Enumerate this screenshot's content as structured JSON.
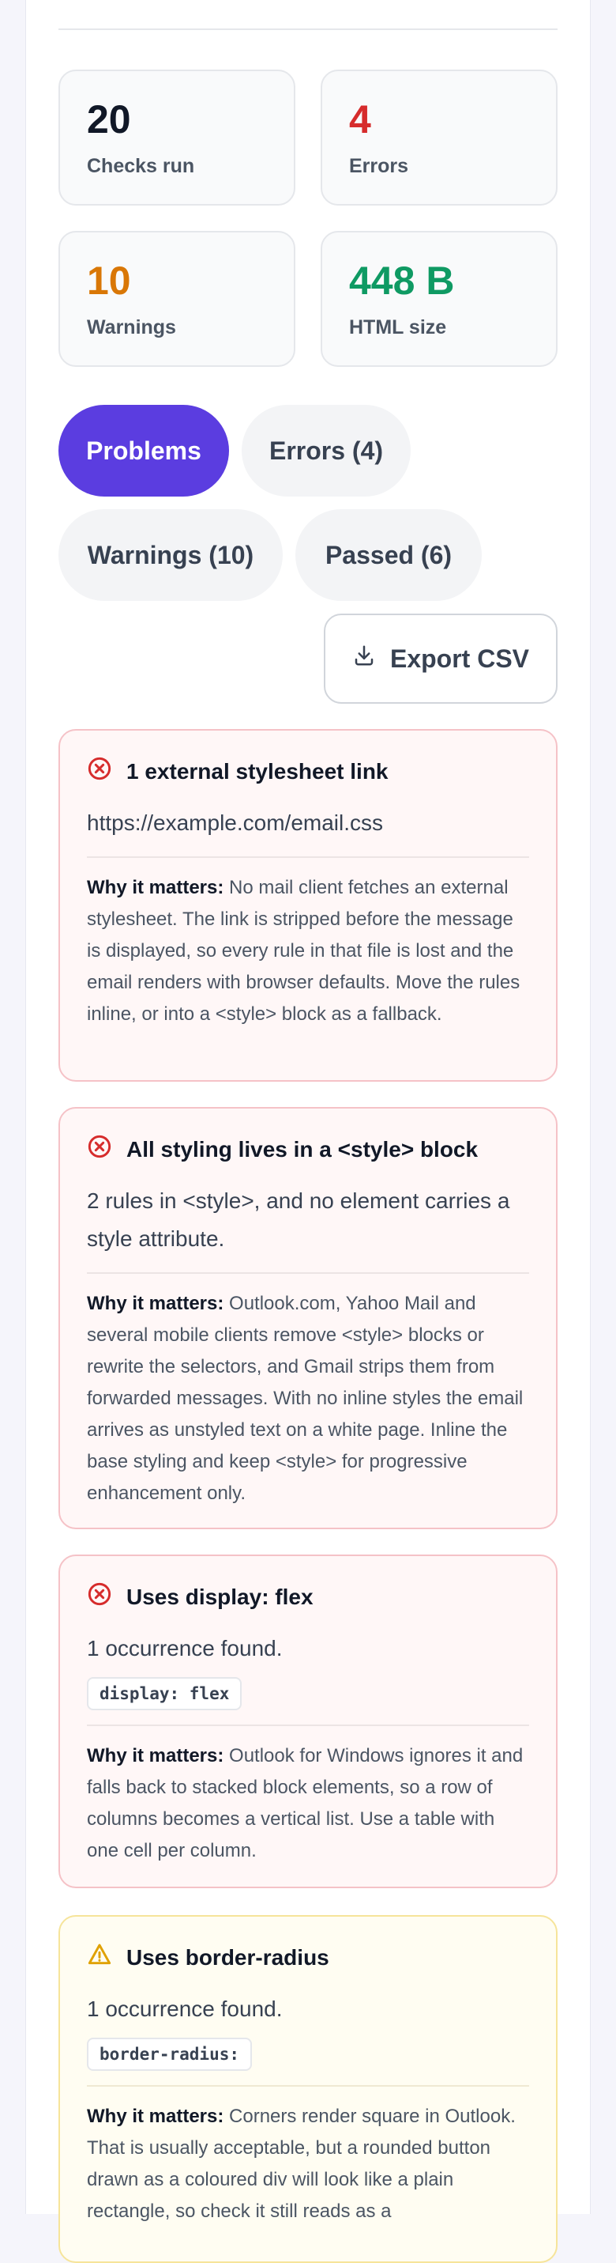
{
  "stats": [
    {
      "value": "20",
      "label": "Checks run",
      "color": "#111827"
    },
    {
      "value": "4",
      "label": "Errors",
      "color": "#d62c2c"
    },
    {
      "value": "10",
      "label": "Warnings",
      "color": "#d97706"
    },
    {
      "value": "448 B",
      "label": "HTML size",
      "color": "#0f9a63"
    }
  ],
  "filters": {
    "problems": "Problems",
    "errors": "Errors (4)",
    "warnings": "Warnings (10)",
    "passed": "Passed (6)",
    "active": "Problems",
    "active_color": "#5b3de0"
  },
  "export_label": "Export CSV",
  "why_label": "Why it matters:",
  "issues": [
    {
      "severity": "error",
      "icon": "error-circle-icon",
      "title": "1 external stylesheet link",
      "detail": "https://example.com/email.css",
      "why": "No mail client fetches an external stylesheet. The link is stripped before the message is displayed, so every rule in that file is lost and the email renders with browser defaults. Move the rules inline, or into a <style> block as a fallback."
    },
    {
      "severity": "error",
      "icon": "error-circle-icon",
      "title": "All styling lives in a <style> block",
      "detail": "2 rules in <style>, and no element carries a style attribute.",
      "why": "Outlook.com, Yahoo Mail and several mobile clients remove <style> blocks or rewrite the selectors, and Gmail strips them from forwarded messages. With no inline styles the email arrives as unstyled text on a white page. Inline the base styling and keep <style> for progressive enhancement only."
    },
    {
      "severity": "error",
      "icon": "error-circle-icon",
      "title": "Uses display: flex",
      "detail": "1 occurrence found.",
      "code": "display: flex",
      "why": "Outlook for Windows ignores it and falls back to stacked block elements, so a row of columns becomes a vertical list. Use a table with one cell per column."
    },
    {
      "severity": "warning",
      "icon": "warning-triangle-icon",
      "title": "Uses border-radius",
      "detail": "1 occurrence found.",
      "code": "border-radius:",
      "why": "Corners render square in Outlook. That is usually acceptable, but a rounded button drawn as a coloured div will look like a plain rectangle, so check it still reads as a"
    }
  ]
}
